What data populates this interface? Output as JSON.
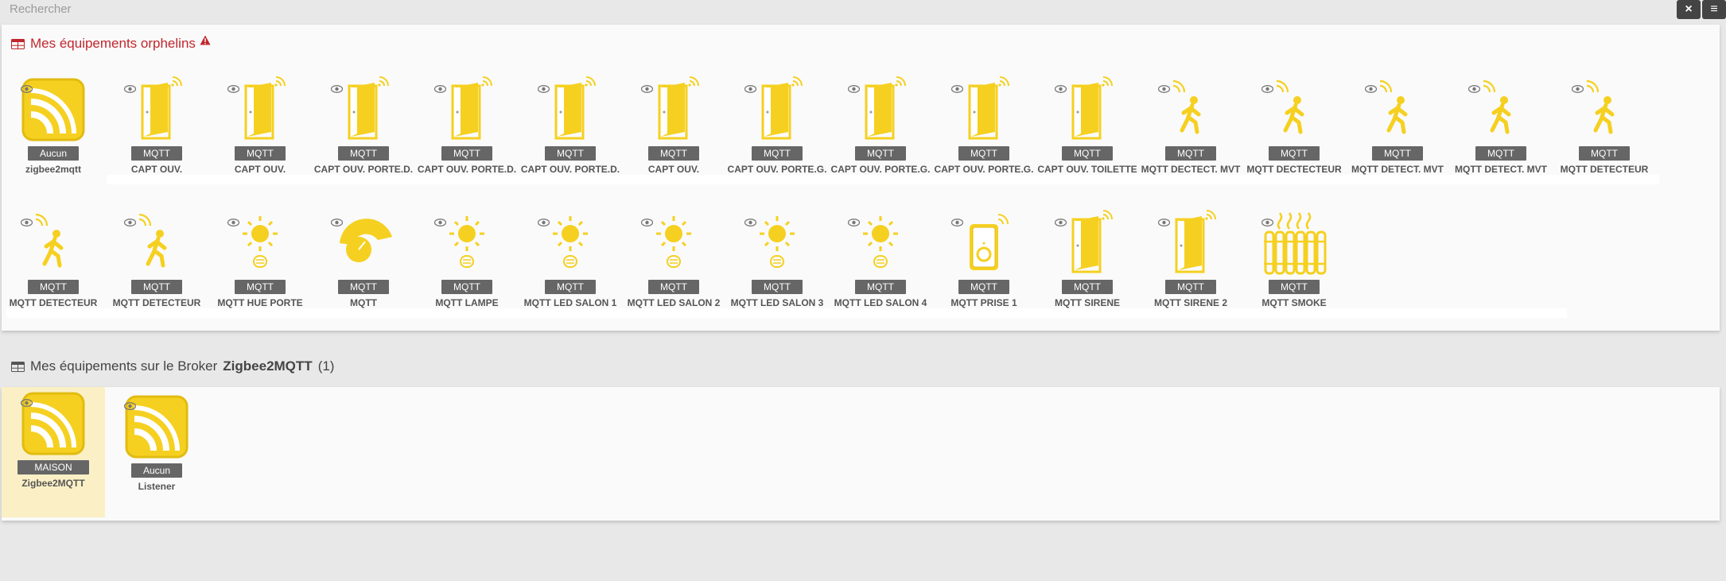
{
  "search": {
    "placeholder": "Rechercher"
  },
  "topbar": {
    "close_label": "×",
    "menu_label": "≡"
  },
  "orphans": {
    "title": "Mes équipements orphelins",
    "row1": [
      {
        "name": "zigbee2mqtt",
        "badge": "Aucun",
        "icon": "rss-icon"
      },
      {
        "name": "CAPT OUV.",
        "badge": "MQTT",
        "icon": "door-icon"
      },
      {
        "name": "CAPT OUV.",
        "badge": "MQTT",
        "icon": "door-icon"
      },
      {
        "name": "CAPT OUV. PORTE.D.",
        "badge": "MQTT",
        "icon": "door-icon"
      },
      {
        "name": "CAPT OUV. PORTE.D.",
        "badge": "MQTT",
        "icon": "door-icon"
      },
      {
        "name": "CAPT OUV. PORTE.D.",
        "badge": "MQTT",
        "icon": "door-icon"
      },
      {
        "name": "CAPT OUV.",
        "badge": "MQTT",
        "icon": "door-icon"
      },
      {
        "name": "CAPT OUV. PORTE.G.",
        "badge": "MQTT",
        "icon": "door-icon"
      },
      {
        "name": "CAPT OUV. PORTE.G.",
        "badge": "MQTT",
        "icon": "door-icon"
      },
      {
        "name": "CAPT OUV. PORTE.G.",
        "badge": "MQTT",
        "icon": "door-icon"
      },
      {
        "name": "CAPT OUV. TOILETTE",
        "badge": "MQTT",
        "icon": "door-icon"
      },
      {
        "name": "MQTT DECTECT. MVT",
        "badge": "MQTT",
        "icon": "motion-icon"
      },
      {
        "name": "MQTT DECTECTEUR",
        "badge": "MQTT",
        "icon": "motion-icon"
      },
      {
        "name": "MQTT DETECT. MVT",
        "badge": "MQTT",
        "icon": "motion-icon"
      },
      {
        "name": "MQTT DETECT. MVT",
        "badge": "MQTT",
        "icon": "motion-icon"
      },
      {
        "name": "MQTT DETECTEUR",
        "badge": "MQTT",
        "icon": "motion-icon"
      }
    ],
    "row2": [
      {
        "name": "MQTT DETECTEUR",
        "badge": "MQTT",
        "icon": "motion-icon"
      },
      {
        "name": "MQTT DETECTEUR",
        "badge": "MQTT",
        "icon": "motion-icon"
      },
      {
        "name": "MQTT HUE PORTE",
        "badge": "MQTT",
        "icon": "light-icon"
      },
      {
        "name": "MQTT",
        "badge": "MQTT",
        "icon": "gauge-icon"
      },
      {
        "name": "MQTT LAMPE",
        "badge": "MQTT",
        "icon": "light-icon"
      },
      {
        "name": "MQTT LED SALON 1",
        "badge": "MQTT",
        "icon": "light-icon"
      },
      {
        "name": "MQTT LED SALON 2",
        "badge": "MQTT",
        "icon": "light-icon"
      },
      {
        "name": "MQTT LED SALON 3",
        "badge": "MQTT",
        "icon": "light-icon"
      },
      {
        "name": "MQTT LED SALON 4",
        "badge": "MQTT",
        "icon": "light-icon"
      },
      {
        "name": "MQTT PRISE 1",
        "badge": "MQTT",
        "icon": "plug-icon"
      },
      {
        "name": "MQTT SIRENE",
        "badge": "MQTT",
        "icon": "door-icon"
      },
      {
        "name": "MQTT SIRENE 2",
        "badge": "MQTT",
        "icon": "door-icon"
      },
      {
        "name": "MQTT SMOKE",
        "badge": "MQTT",
        "icon": "radiator-icon"
      }
    ]
  },
  "broker": {
    "title_prefix": "Mes équipements sur le Broker",
    "broker_name": "Zigbee2MQTT",
    "count": "(1)",
    "items": [
      {
        "name": "Zigbee2MQTT",
        "badge": "MAISON",
        "icon": "rss-icon"
      },
      {
        "name": "Listener",
        "badge": "Aucun",
        "icon": "rss-icon"
      }
    ]
  },
  "colors": {
    "accent": "#f5d020",
    "title_red": "#c0272d",
    "badge": "#666666"
  }
}
